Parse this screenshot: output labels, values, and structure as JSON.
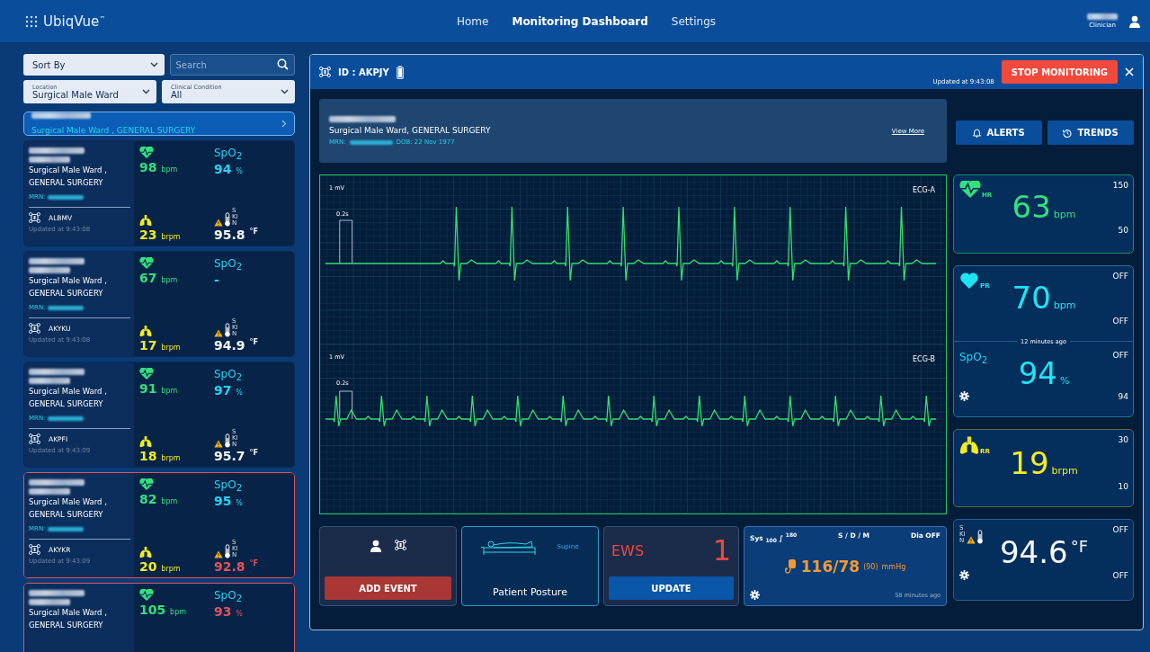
{
  "header": {
    "logo": "UbiqVue",
    "trademark": "™",
    "nav": [
      {
        "label": "Home",
        "selected": false
      },
      {
        "label": "Monitoring Dashboard",
        "selected": true
      },
      {
        "label": "Settings",
        "selected": false
      }
    ],
    "user_role": "Clinician"
  },
  "filters": {
    "sort": "Sort By",
    "search": {
      "placeholder": "Search"
    },
    "location": {
      "label": "Location",
      "value": "Surgical Male Ward"
    },
    "condition": {
      "label": "Clinical Condition",
      "value": "All"
    }
  },
  "summary": {
    "selected": true,
    "location": "Surgical Male Ward , GENERAL SURGERY"
  },
  "patients": [
    {
      "alert": false,
      "location_1": "Surgical Male Ward ,",
      "location_2": "GENERAL SURGERY",
      "mrn_label": "MRN:",
      "device": "ALBMV",
      "updated": "Updated at 9:43:08",
      "hr": "98",
      "hr_unit": "bpm",
      "spo2_label": "SpO$_{2}$",
      "spo2": "94",
      "spo2_unit": "%",
      "spo2_alarm": false,
      "rr": "23",
      "rr_unit": "brpm",
      "temp_site": "SKIN",
      "temp_warning": true,
      "temp": "95.8",
      "temp_unit": "°F",
      "temp_alarm": false
    },
    {
      "alert": false,
      "location_1": "Surgical Male Ward ,",
      "location_2": "GENERAL SURGERY",
      "mrn_label": "MRN:",
      "device": "AKYKU",
      "updated": "Updated at 9:43:08",
      "hr": "67",
      "hr_unit": "bpm",
      "spo2_label": "SpO$_{2}$",
      "spo2": "-",
      "spo2_alarm": false,
      "rr": "17",
      "rr_unit": "brpm",
      "temp_site": "SKIN",
      "temp_warning": true,
      "temp": "94.9",
      "temp_unit": "°F",
      "temp_alarm": false
    },
    {
      "alert": false,
      "location_1": "Surgical Male Ward ,",
      "location_2": "GENERAL SURGERY",
      "mrn_label": "MRN:",
      "device": "AKPFI",
      "updated": "Updated at 9:43:09",
      "hr": "91",
      "hr_unit": "bpm",
      "spo2_label": "SpO$_{2}$",
      "spo2": "97",
      "spo2_unit": "%",
      "spo2_alarm": false,
      "rr": "18",
      "rr_unit": "brpm",
      "temp_site": "SKIN",
      "temp_warning": true,
      "temp": "95.7",
      "temp_unit": "°F",
      "temp_alarm": false
    },
    {
      "alert": true,
      "location_1": "Surgical Male Ward ,",
      "location_2": "GENERAL SURGERY",
      "mrn_label": "MRN:",
      "device": "AKYKR",
      "updated": "Updated at 9:43:09",
      "hr": "82",
      "hr_unit": "bpm",
      "spo2_label": "SpO$_{2}$",
      "spo2": "95",
      "spo2_unit": "%",
      "spo2_alarm": false,
      "rr": "20",
      "rr_unit": "brpm",
      "temp_site": "SKIN",
      "temp_warning": true,
      "temp": "92.8",
      "temp_unit": "°F",
      "temp_alarm": true
    },
    {
      "alert": true,
      "location_1": "Surgical Male Ward ,",
      "location_2": "GENERAL SURGERY",
      "hr": "105",
      "hr_unit": "bpm",
      "spo2_label": "SpO$_{2}$",
      "spo2": "93",
      "spo2_unit": "%",
      "spo2_alarm": true
    }
  ],
  "monitor": {
    "device_id": "ID : AKPJY",
    "updated": "Updated at 9:43:08",
    "stop_button": "STOP MONITORING",
    "patient": {
      "location": "Surgical Male Ward, GENERAL SURGERY",
      "mrn_label": "MRN:",
      "dob": "DOB: 22 Nov 1977",
      "view_more": "View More"
    },
    "actions": [
      {
        "kind": "alerts",
        "label": "ALERTS"
      },
      {
        "kind": "trends",
        "label": "TRENDS"
      }
    ],
    "ecg": [
      {
        "lead": "ECG-A",
        "scale": "1 mV",
        "time": "0.2s"
      },
      {
        "lead": "ECG-B",
        "scale": "1 mV",
        "time": "0.2s"
      }
    ],
    "vitals": [
      {
        "sections": [
          {
            "kind": "hr",
            "label": "HR",
            "value": "63",
            "unit": "bpm",
            "high": "150",
            "low": "50",
            "settings": false
          }
        ]
      },
      {
        "ago": "12 minutes ago",
        "sections": [
          {
            "kind": "pr",
            "label": "PR",
            "value": "70",
            "unit": "bpm",
            "high": "OFF",
            "low": "OFF",
            "settings": false
          },
          {
            "kind": "spo2",
            "label": "SpO$_{2}$",
            "value": "94",
            "unit": "%",
            "high": "OFF",
            "low": "94",
            "settings": true
          }
        ]
      },
      {
        "sections": [
          {
            "kind": "rr",
            "label": "RR",
            "value": "19",
            "unit": "brpm",
            "high": "30",
            "low": "10",
            "settings": false
          }
        ]
      },
      {
        "sections": [
          {
            "kind": "temp",
            "label": "SKIN",
            "warning": true,
            "value": "94.6",
            "unit": "°F",
            "high": "OFF",
            "low": "OFF",
            "settings": true
          }
        ]
      }
    ],
    "event": {
      "button": "ADD EVENT"
    },
    "posture": {
      "position": "Supine",
      "label": "Patient Posture"
    },
    "ews": {
      "label": "EWS",
      "score": "1",
      "button": "UPDATE"
    },
    "bp": {
      "range": "Sys $_{100}$ ∫ $^{180}$",
      "mode": "S / D / M",
      "dia": "Dia OFF",
      "value": "116/78",
      "mean": "(90)",
      "unit": "mmHg",
      "settings": true,
      "ago": "58 minutes ago"
    }
  }
}
